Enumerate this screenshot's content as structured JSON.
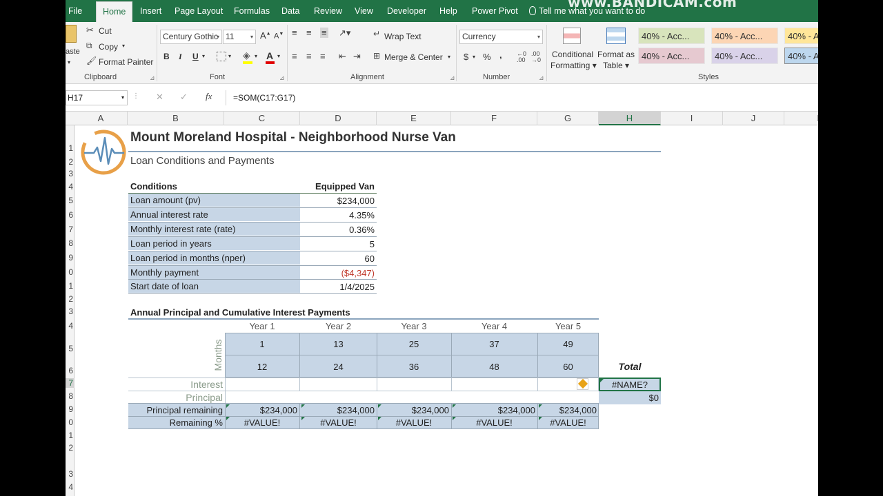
{
  "watermark": "www.BANDICAM.com",
  "ribbon_tabs": [
    "File",
    "Home",
    "Insert",
    "Page Layout",
    "Formulas",
    "Data",
    "Review",
    "View",
    "Developer",
    "Help",
    "Power Pivot"
  ],
  "tell_me": "Tell me what you want to do",
  "clipboard": {
    "paste": "aste",
    "cut": "Cut",
    "copy": "Copy",
    "format_painter": "Format Painter",
    "label": "Clipboard"
  },
  "font": {
    "name": "Century Gothic",
    "size": "11",
    "bold": "B",
    "italic": "I",
    "underline": "U",
    "font_color_glyph": "A",
    "label": "Font"
  },
  "alignment": {
    "wrap_text": "Wrap Text",
    "merge_center": "Merge & Center",
    "label": "Alignment"
  },
  "number": {
    "format": "Currency",
    "dollar": "$",
    "percent": "%",
    "comma": "‚",
    "label": "Number"
  },
  "styles_group": {
    "conditional": [
      "Conditional",
      "Formatting"
    ],
    "format_table": [
      "Format as",
      "Table"
    ],
    "tiles": [
      {
        "text": "40% - Acc...",
        "color": "#d8e4bc"
      },
      {
        "text": "40% - Acc...",
        "color": "#fcd5b4"
      },
      {
        "text": "40% - A",
        "color": "#ffe699"
      },
      {
        "text": "40% - Acc...",
        "color": "#e6c9d0"
      },
      {
        "text": "40% - Acc...",
        "color": "#d9d2e9"
      },
      {
        "text": "40% - A",
        "color": "#bdd7ee"
      }
    ],
    "label": "Styles"
  },
  "name_box": "H17",
  "formula": "=SOM(C17:G17)",
  "columns": [
    "A",
    "B",
    "C",
    "D",
    "E",
    "F",
    "G",
    "H",
    "I",
    "J",
    "K"
  ],
  "rows": [
    "1",
    "2",
    "3",
    "4",
    "5",
    "6",
    "7",
    "8",
    "9",
    "0",
    "1",
    "2",
    "3",
    "4",
    "5",
    "6",
    "7",
    "8",
    "9",
    "0",
    "1",
    "2",
    "3",
    "4"
  ],
  "sheet": {
    "title": "Mount Moreland Hospital - Neighborhood Nurse Van",
    "subtitle": "Loan Conditions and Payments",
    "cond_header": "Conditions",
    "van_header": "Equipped Van",
    "conditions": [
      {
        "label": "Loan amount (pv)",
        "value": "$234,000"
      },
      {
        "label": "Annual interest rate",
        "value": "4.35%"
      },
      {
        "label": "Monthly interest rate (rate)",
        "value": "0.36%"
      },
      {
        "label": "Loan period in years",
        "value": "5"
      },
      {
        "label": "Loan period in months (nper)",
        "value": "60"
      },
      {
        "label": "Monthly payment",
        "value": "($4,347)"
      },
      {
        "label": "Start date of loan",
        "value": "1/4/2025"
      }
    ],
    "annual_header": "Annual Principal and Cumulative Interest Payments",
    "years": [
      "Year 1",
      "Year 2",
      "Year 3",
      "Year 4",
      "Year 5"
    ],
    "months_label": "Months",
    "start_months": [
      "1",
      "13",
      "25",
      "37",
      "49"
    ],
    "end_months": [
      "12",
      "24",
      "36",
      "48",
      "60"
    ],
    "total_label": "Total",
    "interest_label": "Interest",
    "principal_label": "Principal",
    "interest_total": "#NAME?",
    "principal_total": "$0",
    "remaining_label": "Principal remaining",
    "remaining_values": [
      "$234,000",
      "$234,000",
      "$234,000",
      "$234,000",
      "$234,000"
    ],
    "remaining_pct_label": "Remaining %",
    "remaining_pct_values": [
      "#VALUE!",
      "#VALUE!",
      "#VALUE!",
      "#VALUE!",
      "#VALUE!"
    ]
  },
  "colors": {
    "excel_green": "#217346",
    "cell_blue": "#c7d6e6",
    "negative": "#c0392b",
    "logo_orange": "#e8a048"
  }
}
